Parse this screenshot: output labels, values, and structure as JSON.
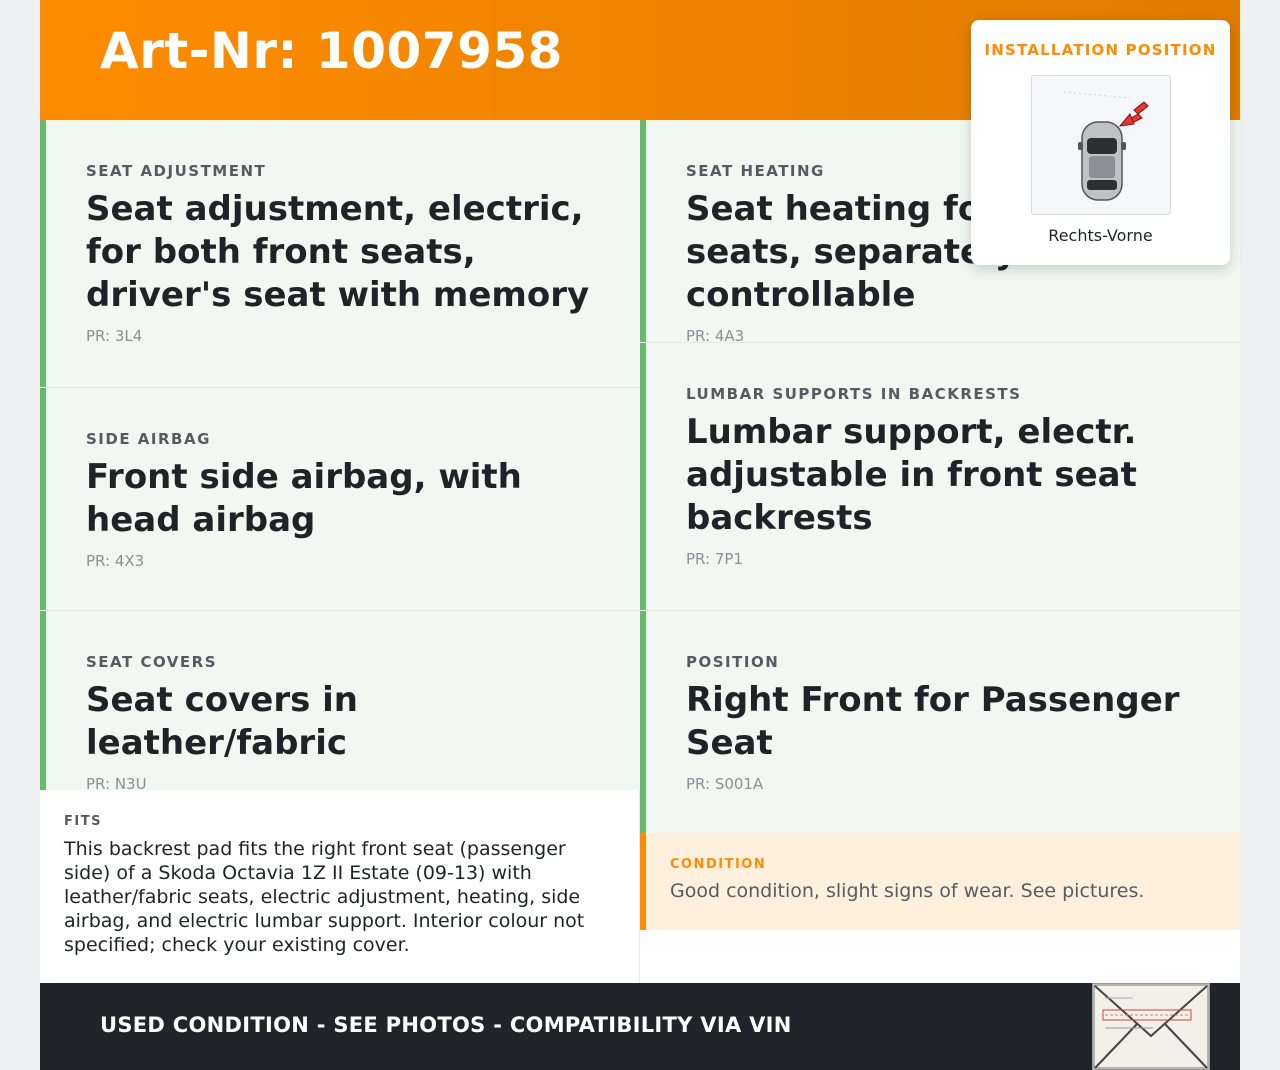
{
  "header": {
    "title": "Art-Nr: 1007958"
  },
  "cards": [
    {
      "category": "SEAT ADJUSTMENT",
      "title": "Seat adjustment, electric, for both front seats, driver's seat with memory",
      "pr": "PR: 3L4"
    },
    {
      "category": "SEAT HEATING",
      "title": "Seat heating for front seats, separately controllable",
      "pr": "PR: 4A3"
    },
    {
      "category": "SIDE AIRBAG",
      "title": "Front side airbag, with head airbag",
      "pr": "PR: 4X3"
    },
    {
      "category": "LUMBAR SUPPORTS IN BACKRESTS",
      "title": "Lumbar support, electr. adjustable in front seat backrests",
      "pr": "PR: 7P1"
    },
    {
      "category": "SEAT COVERS",
      "title": "Seat covers in leather/fabric",
      "pr": "PR: N3U"
    },
    {
      "category": "POSITION",
      "title": "Right Front for Passenger Seat",
      "pr": "PR: S001A"
    }
  ],
  "fits": {
    "label": "FITS",
    "text": "This backrest pad fits the right front seat (passenger side) of a Skoda Octavia 1Z II Estate (09-13) with leather/fabric seats, electric adjustment, heating, side airbag, and electric lumbar support. Interior colour not specified; check your existing cover."
  },
  "condition": {
    "label": "CONDITION",
    "text": "Good condition, slight signs of wear. See pictures."
  },
  "footer": {
    "text": "USED CONDITION - SEE PHOTOS - COMPATIBILITY VIA VIN"
  },
  "install": {
    "label": "INSTALLATION POSITION",
    "position": "Rechts-Vorne"
  },
  "colors": {
    "accent": "#ff8c00",
    "card_bg": "#f1f8f1",
    "card_border": "#66bb6a",
    "condition_bg": "#fff0de",
    "footer_bg": "#212429"
  }
}
